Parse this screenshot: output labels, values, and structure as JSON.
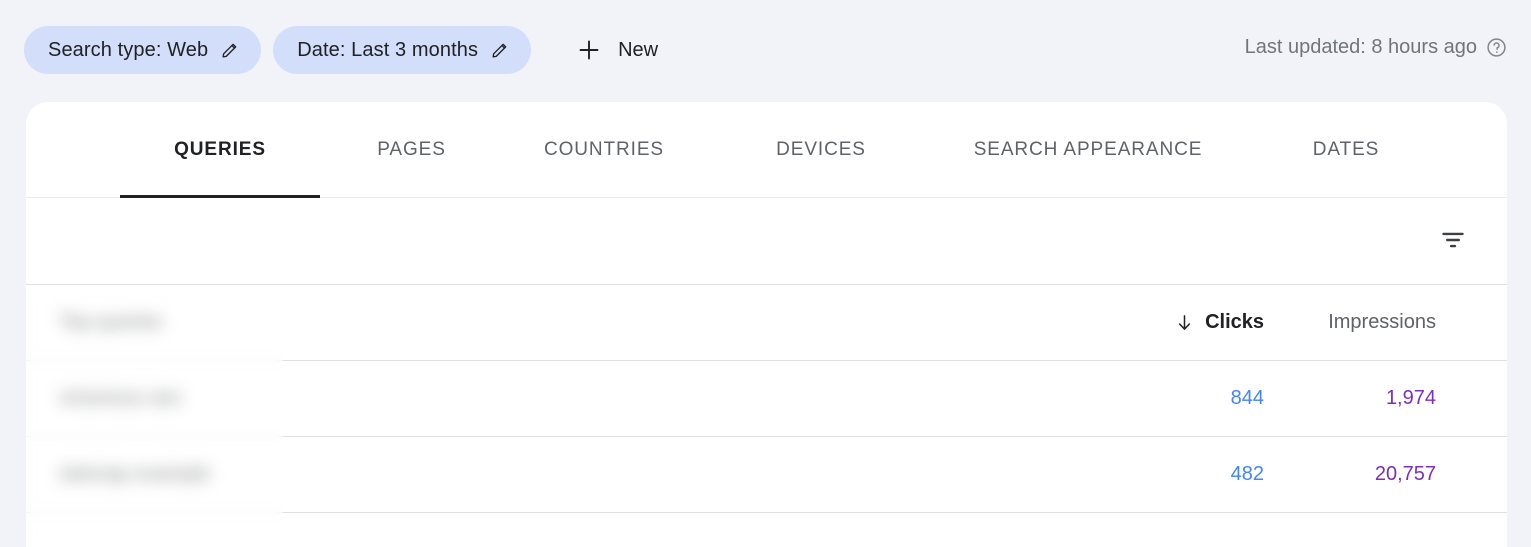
{
  "filter_bar": {
    "chips": [
      {
        "label": "Search type: Web",
        "edit_icon": "pencil-icon"
      },
      {
        "label": "Date: Last 3 months",
        "edit_icon": "pencil-icon"
      }
    ],
    "new_button": {
      "label": "New",
      "icon": "plus-icon"
    },
    "last_updated": {
      "text": "Last updated: 8 hours ago",
      "icon": "help-circle-icon"
    }
  },
  "tabs": [
    {
      "label": "QUERIES",
      "active": true
    },
    {
      "label": "PAGES",
      "active": false
    },
    {
      "label": "COUNTRIES",
      "active": false
    },
    {
      "label": "DEVICES",
      "active": false
    },
    {
      "label": "SEARCH APPEARANCE",
      "active": false
    },
    {
      "label": "DATES",
      "active": false
    }
  ],
  "toolbar": {
    "filter_icon": "filter-funnel-icon"
  },
  "table": {
    "columns": {
      "query": "Top queries",
      "clicks": "Clicks",
      "impressions": "Impressions"
    },
    "sort": {
      "column": "Clicks",
      "direction": "descending",
      "icon": "arrow-down-icon"
    },
    "rows": [
      {
        "query": "victorious seo",
        "clicks": "844",
        "impressions": "1,974"
      },
      {
        "query": "sitemap example",
        "clicks": "482",
        "impressions": "20,757"
      }
    ]
  },
  "colors": {
    "page_background": "#F1F3F9",
    "card_background": "#FFFFFF",
    "chip_background": "#D3DEFA",
    "clicks_value": "#4285F4",
    "impressions_value": "#7B2FBE",
    "active_tab": "#202124",
    "inactive_tab": "#5F6368",
    "muted_text": "#70757A",
    "divider": "#E0E0E0"
  }
}
